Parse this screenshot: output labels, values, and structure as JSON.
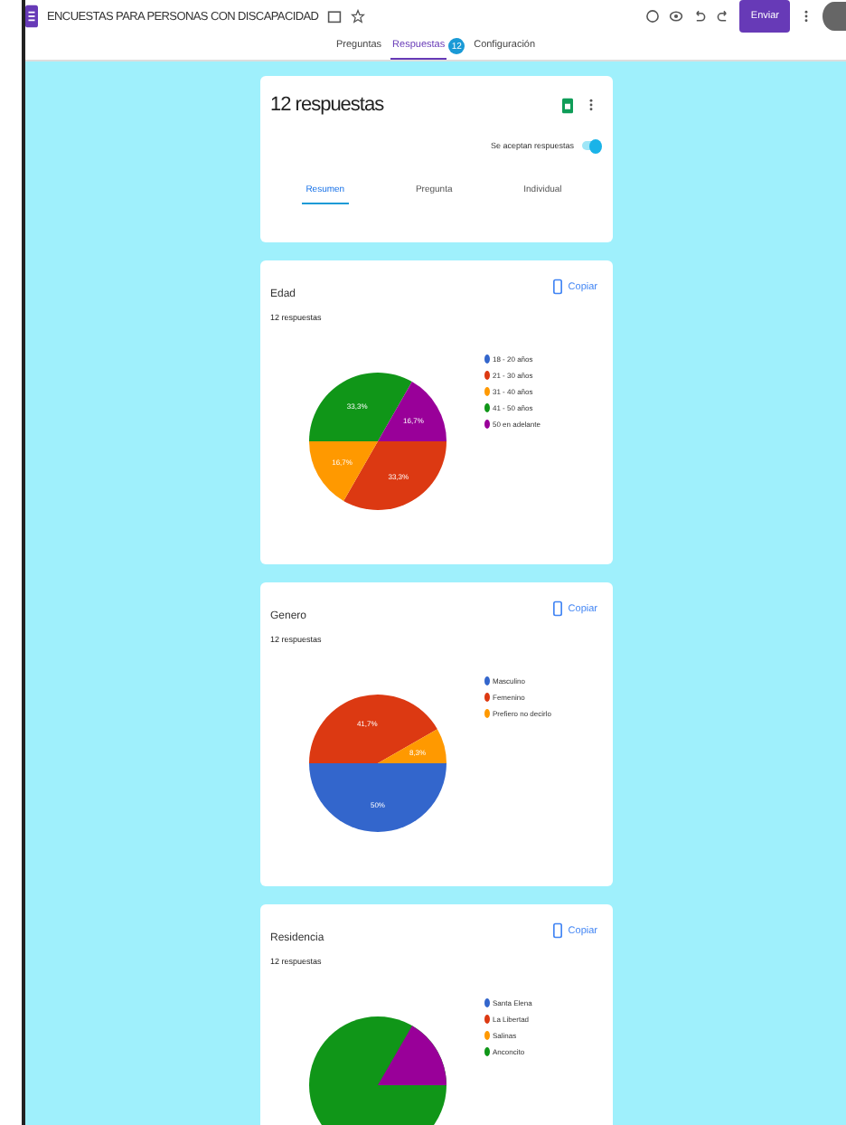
{
  "header": {
    "title": "ENCUESTAS PARA PERSONAS CON DISCAPACIDAD",
    "send_button": "Enviar"
  },
  "tabs": [
    {
      "label": "Preguntas",
      "selected": false
    },
    {
      "label": "Respuestas",
      "badge": "12",
      "selected": true
    },
    {
      "label": "Configuración",
      "selected": false
    }
  ],
  "summary": {
    "title": "12 respuestas",
    "accepting_label": "Se aceptan respuestas",
    "accepting": true,
    "tabs": [
      {
        "label": "Resumen",
        "selected": true
      },
      {
        "label": "Pregunta",
        "selected": false
      },
      {
        "label": "Individual",
        "selected": false
      }
    ]
  },
  "questions": [
    {
      "kind": "pie",
      "title": "Edad",
      "count": "12 respuestas",
      "copy_label": "Copiar",
      "chart_data": {
        "type": "pie",
        "categories": [
          "18 - 20 años",
          "21 - 30 años",
          "31 - 40 años",
          "41 - 50 años",
          "50 en adelante"
        ],
        "series": [
          {
            "values": [
              0,
              33.3,
              16.7,
              33.3,
              16.7
            ]
          }
        ],
        "data_labels": "value_labels",
        "value_labels": [
          null,
          "33,3%",
          "16,7%",
          "33,3%",
          "16,7%"
        ],
        "legend": "right"
      }
    },
    {
      "kind": "pie",
      "title": "Genero",
      "count": "12 respuestas",
      "copy_label": "Copiar",
      "chart_data": {
        "type": "pie",
        "categories": [
          "Masculino",
          "Femenino",
          "Prefiero no decirlo"
        ],
        "series": [
          {
            "values": [
              50,
              41.7,
              8.3
            ]
          }
        ],
        "data_labels": "value_labels",
        "value_labels": [
          "50%",
          "41,7%",
          "8,3%"
        ],
        "legend": "right"
      }
    },
    {
      "kind": "pie_cut",
      "title": "Residencia",
      "count": "12 respuestas",
      "copy_label": "Copiar",
      "legend": [
        "Santa Elena",
        "La Libertad",
        "Salinas",
        "Anconcito"
      ]
    }
  ]
}
